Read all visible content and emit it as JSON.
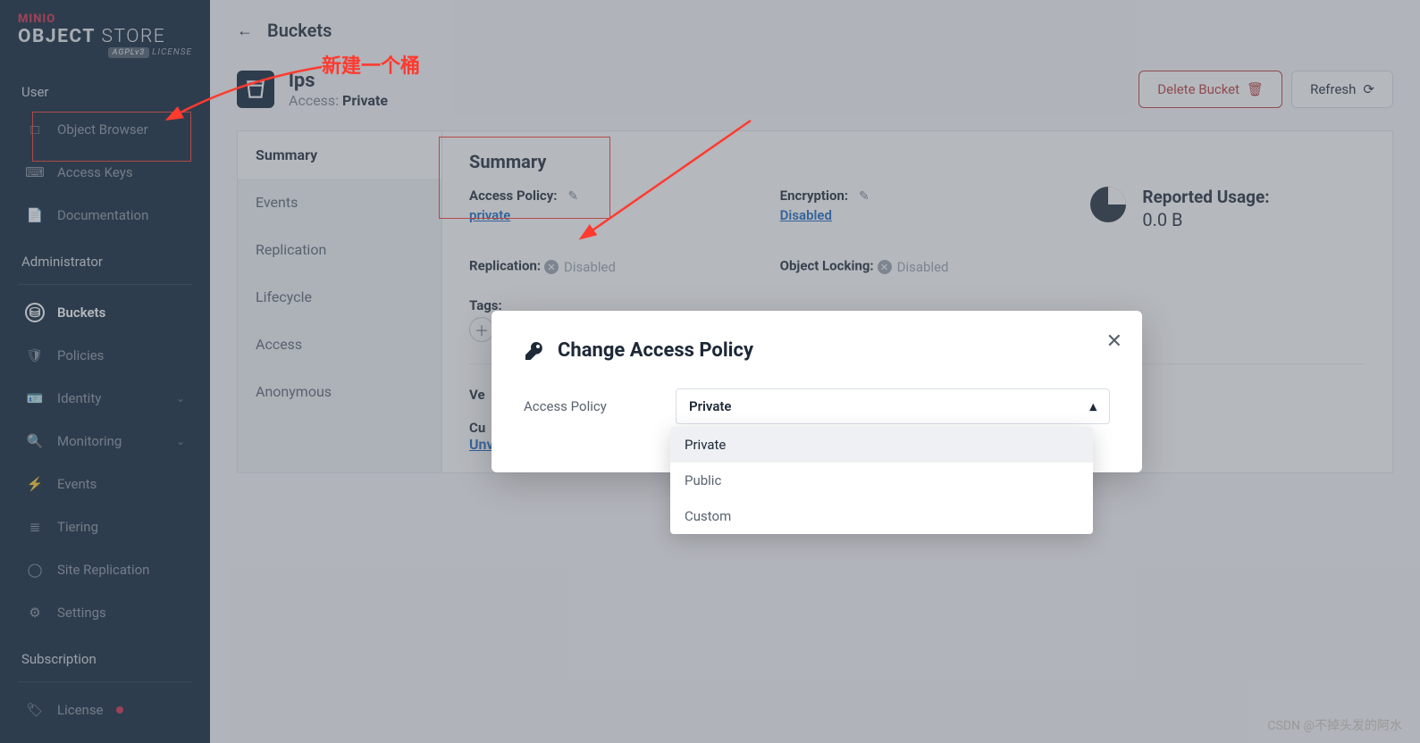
{
  "sidebar": {
    "brand_top": "MINIO",
    "brand_main_a": "OBJECT",
    "brand_main_b": "STORE",
    "license_tag": "AGPLv3",
    "license_word": "LICENSE",
    "groups": [
      {
        "label": "User",
        "items": [
          {
            "name": "object-browser",
            "label": "Object Browser",
            "icon": "□"
          },
          {
            "name": "access-keys",
            "label": "Access Keys",
            "icon": "⌨"
          },
          {
            "name": "documentation",
            "label": "Documentation",
            "icon": "📄"
          }
        ]
      },
      {
        "label": "Administrator",
        "items": [
          {
            "name": "buckets",
            "label": "Buckets",
            "icon": "⛁",
            "active": true
          },
          {
            "name": "policies",
            "label": "Policies",
            "icon": "🛡"
          },
          {
            "name": "identity",
            "label": "Identity",
            "icon": "🪪",
            "chev": true
          },
          {
            "name": "monitoring",
            "label": "Monitoring",
            "icon": "🔍",
            "chev": true
          },
          {
            "name": "events",
            "label": "Events",
            "icon": "⚡"
          },
          {
            "name": "tiering",
            "label": "Tiering",
            "icon": "≣"
          },
          {
            "name": "site-replication",
            "label": "Site Replication",
            "icon": "◯"
          },
          {
            "name": "settings",
            "label": "Settings",
            "icon": "⚙"
          }
        ]
      },
      {
        "label": "Subscription",
        "items": [
          {
            "name": "license",
            "label": "License",
            "icon": "🏷",
            "dot": true
          }
        ]
      }
    ]
  },
  "topbar": {
    "title": "Buckets"
  },
  "bucket": {
    "name": "lps",
    "access_label": "Access:",
    "access_value": "Private"
  },
  "actions": {
    "delete": "Delete Bucket",
    "refresh": "Refresh"
  },
  "tabs": [
    "Summary",
    "Events",
    "Replication",
    "Lifecycle",
    "Access",
    "Anonymous"
  ],
  "summary": {
    "heading": "Summary",
    "access_policy_label": "Access Policy:",
    "access_policy_value": "private",
    "encryption_label": "Encryption:",
    "encryption_value": "Disabled",
    "replication_label": "Replication:",
    "replication_value": "Disabled",
    "object_locking_label": "Object Locking:",
    "object_locking_value": "Disabled",
    "tags_label": "Tags:",
    "versioning_label_trunc": "Ve",
    "current_label_trunc": "Cu",
    "unv_trunc": "Unv",
    "usage_label": "Reported Usage:",
    "usage_value": "0.0 B"
  },
  "modal": {
    "title": "Change Access Policy",
    "field_label": "Access Policy",
    "selected": "Private",
    "options": [
      "Private",
      "Public",
      "Custom"
    ]
  },
  "annotations": {
    "new_bucket": "新建一个桶"
  },
  "watermark": "CSDN @不掉头发的阿水"
}
